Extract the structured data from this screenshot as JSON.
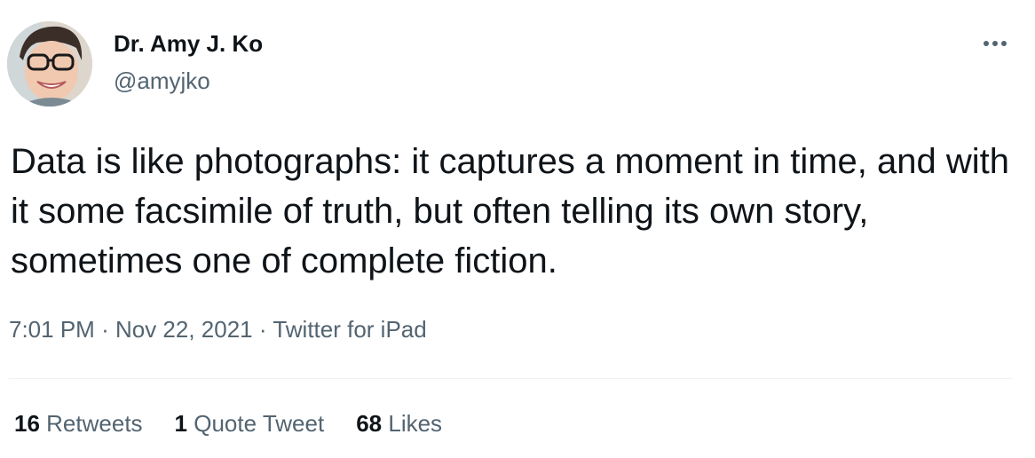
{
  "author": {
    "display_name": "Dr. Amy J. Ko",
    "handle": "@amyjko"
  },
  "tweet": {
    "text": "Data is like photographs: it captures a moment in time, and with it some facsimile of truth, but often telling its own story, sometimes one of complete fiction.",
    "time": "7:01 PM",
    "date": "Nov 22, 2021",
    "source": "Twitter for iPad",
    "separator": "·"
  },
  "stats": {
    "retweets_count": "16",
    "retweets_label": "Retweets",
    "quotes_count": "1",
    "quotes_label": "Quote Tweet",
    "likes_count": "68",
    "likes_label": "Likes"
  },
  "icons": {
    "more": "more-icon",
    "avatar": "avatar-photo"
  },
  "colors": {
    "text_primary": "#0f1419",
    "text_secondary": "#536471",
    "divider": "#eff3f4"
  }
}
